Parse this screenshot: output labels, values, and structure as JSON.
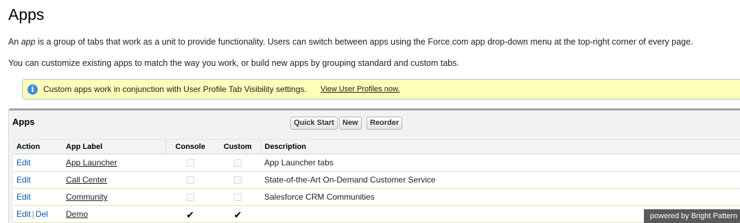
{
  "page": {
    "title": "Apps",
    "intro_prefix": "An ",
    "intro_em": "app",
    "intro_rest": " is a group of tabs that work as a unit to provide functionality. Users can switch between apps using the Force.com app drop-down menu at the top-right corner of every page.",
    "intro2": "You can customize existing apps to match the way you work, or build new apps by grouping standard and custom tabs."
  },
  "info": {
    "icon": "info-icon",
    "text": "Custom apps work in conjunction with User Profile Tab Visibility settings.",
    "link": "View User Profiles now."
  },
  "panel": {
    "title": "Apps",
    "buttons": {
      "quick_start": "Quick Start",
      "new": "New",
      "reorder": "Reorder"
    }
  },
  "table": {
    "headers": {
      "action": "Action",
      "label": "App Label",
      "console": "Console",
      "custom": "Custom",
      "description": "Description"
    },
    "rows": [
      {
        "edit": "Edit",
        "del": "",
        "label": "App Launcher",
        "console": false,
        "custom": false,
        "description": "App Launcher tabs"
      },
      {
        "edit": "Edit",
        "del": "",
        "label": "Call Center",
        "console": false,
        "custom": false,
        "description": "State-of-the-Art On-Demand Customer Service"
      },
      {
        "edit": "Edit",
        "del": "",
        "label": "Community",
        "console": false,
        "custom": false,
        "description": "Salesforce CRM Communities"
      },
      {
        "edit": "Edit",
        "del": "Del",
        "separator": "|",
        "label": "Demo",
        "console": true,
        "custom": true,
        "description": ""
      }
    ]
  },
  "footer": {
    "powered": "powered by Bright Pattern"
  }
}
